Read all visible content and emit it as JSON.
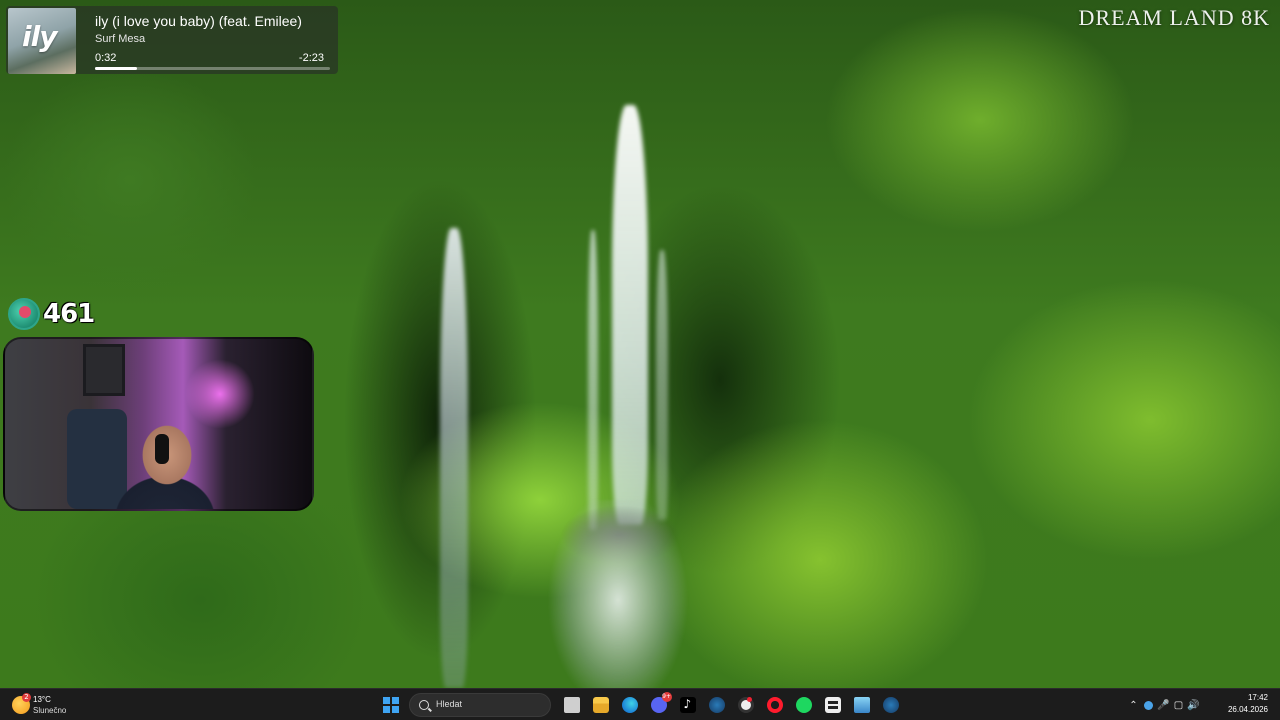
{
  "wallpaper": {
    "watermark": "DREAM LAND 8K"
  },
  "now_playing": {
    "art_text": "ily",
    "title": "ily (i love you baby) (feat. Emilee)",
    "artist": "Surf Mesa",
    "elapsed": "0:32",
    "remaining": "-2:23",
    "progress": 0.18
  },
  "follower_counter": {
    "value": "461",
    "icon": "follower-goal-icon"
  },
  "webcam": {
    "label": ""
  },
  "taskbar": {
    "weather": {
      "badge": "2",
      "temperature": "13°C",
      "condition": "Slunečno"
    },
    "search": {
      "placeholder": "Hledat"
    },
    "apps": [
      {
        "name": "start-icon"
      },
      {
        "name": "task-view-icon"
      },
      {
        "name": "file-explorer-icon"
      },
      {
        "name": "edge-icon"
      },
      {
        "name": "discord-icon",
        "badge": "9+"
      },
      {
        "name": "tiktok-icon"
      },
      {
        "name": "steam-icon"
      },
      {
        "name": "obs-icon"
      },
      {
        "name": "opera-gx-icon"
      },
      {
        "name": "spotify-icon"
      },
      {
        "name": "app-icon"
      },
      {
        "name": "photos-icon"
      },
      {
        "name": "steam-icon"
      }
    ],
    "clock": {
      "time": "17:42",
      "date": "26.04.2026"
    },
    "accent_color": "#3fa4f2"
  }
}
